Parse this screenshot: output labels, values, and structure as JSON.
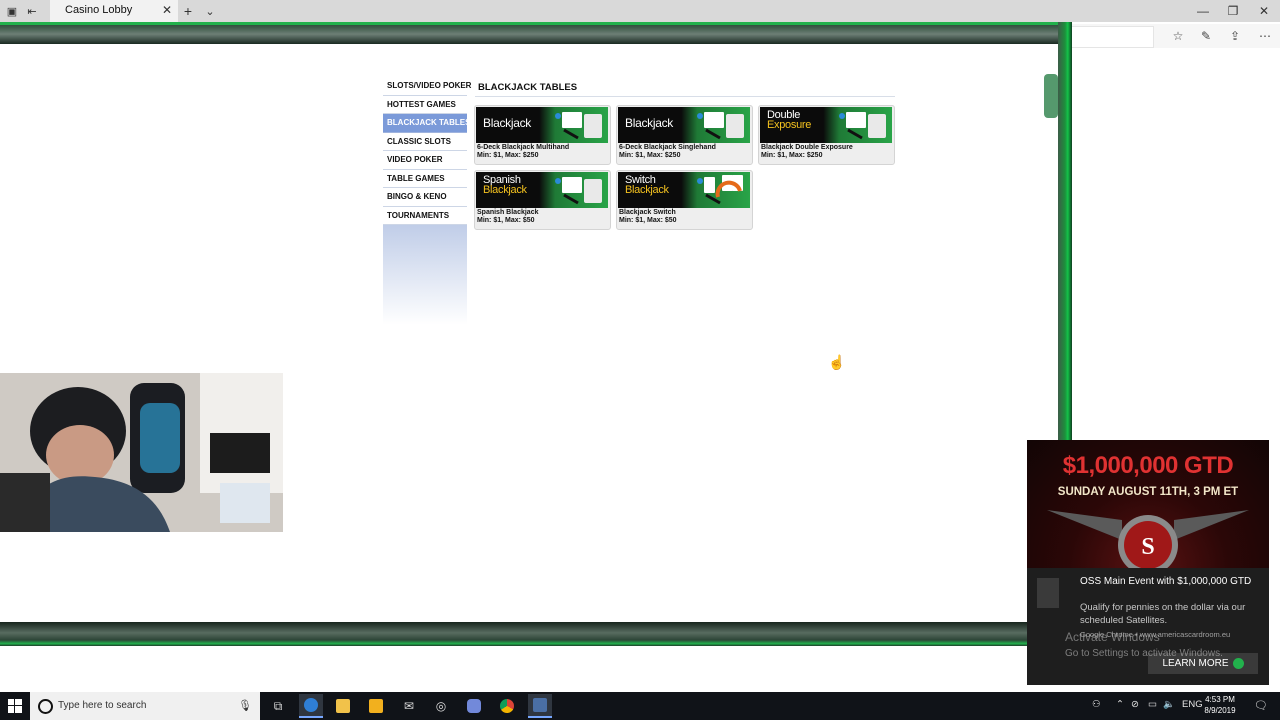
{
  "browser": {
    "tab_title": "Casino Lobby",
    "new_tab": "+",
    "tab_menu": "⌄",
    "close_tab": "✕",
    "window": {
      "minimize": "—",
      "restore": "❐",
      "close": "✕"
    },
    "toolbar_icons": [
      "reading-list-icon",
      "pen-icon",
      "share-icon",
      "more-icon"
    ]
  },
  "lobby": {
    "menu": [
      {
        "label": "SLOTS/VIDEO POKER",
        "active": false
      },
      {
        "label": "HOTTEST GAMES",
        "active": false
      },
      {
        "label": "BLACKJACK TABLES",
        "active": true
      },
      {
        "label": "CLASSIC SLOTS",
        "active": false
      },
      {
        "label": "VIDEO POKER",
        "active": false
      },
      {
        "label": "TABLE GAMES",
        "active": false
      },
      {
        "label": "BINGO & KENO",
        "active": false
      },
      {
        "label": "TOURNAMENTS",
        "active": false
      }
    ],
    "section_title": "BLACKJACK TABLES",
    "games": [
      {
        "logo_line1": "Blackjack",
        "logo_line2": "",
        "name": "6-Deck Blackjack Multihand",
        "limits": "Min: $1, Max: $250"
      },
      {
        "logo_line1": "Blackjack",
        "logo_line2": "",
        "name": "6-Deck Blackjack Singlehand",
        "limits": "Min: $1, Max: $250"
      },
      {
        "logo_line1": "Double",
        "logo_line2": "Exposure",
        "name": "Blackjack Double Exposure",
        "limits": "Min: $1, Max: $250"
      },
      {
        "logo_line1": "Spanish",
        "logo_line2": "Blackjack",
        "name": "Spanish Blackjack",
        "limits": "Min: $1, Max: $50"
      },
      {
        "logo_line1": "Switch",
        "logo_line2": "Blackjack",
        "name": "Blackjack Switch",
        "limits": "Min: $1, Max: $50"
      }
    ]
  },
  "ad": {
    "amount": "$1,000,000 GTD",
    "date": "SUNDAY AUGUST 11TH, 3 PM ET",
    "title": "OSS Main Event with $1,000,000 GTD",
    "description": "Qualify for pennies on the dollar via our scheduled Satellites.",
    "source": "Google Chrome • www.americascardroom.eu",
    "button": "LEARN MORE",
    "watermark_line1": "Activate Windows",
    "watermark_line2": "Go to Settings to activate Windows."
  },
  "taskbar": {
    "search_placeholder": "Type here to search",
    "language": "ENG",
    "time": "4:53 PM",
    "date": "8/9/2019"
  }
}
